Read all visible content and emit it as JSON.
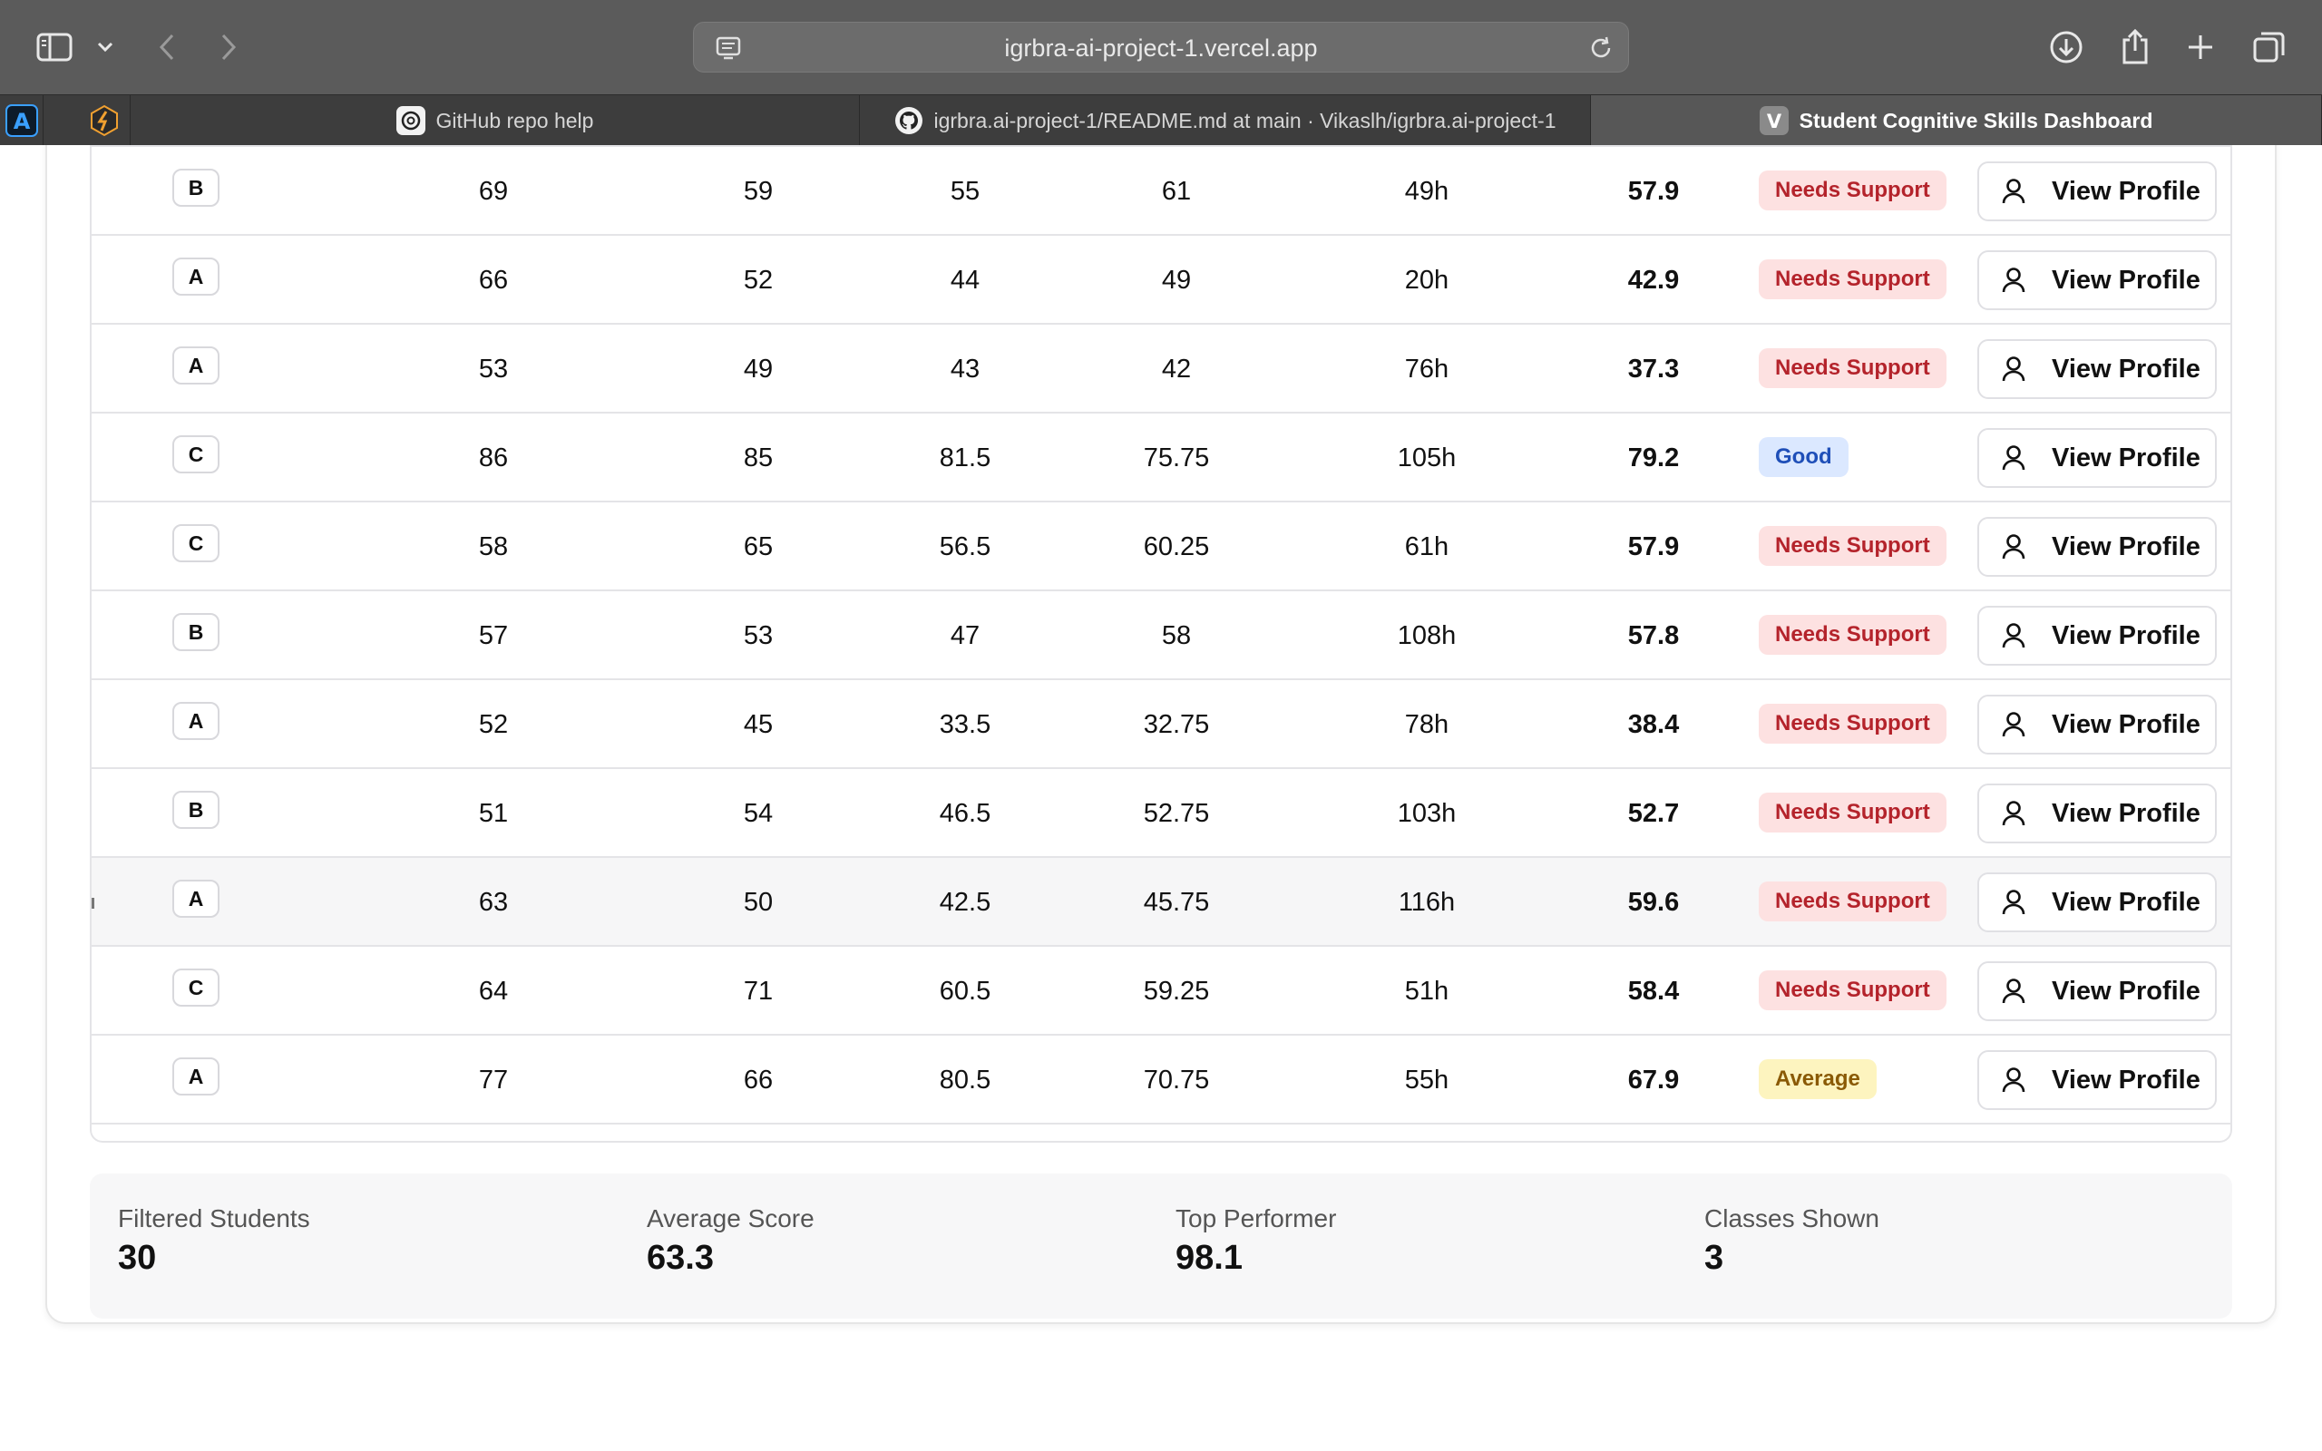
{
  "browser": {
    "url": "igrbra-ai-project-1.vercel.app",
    "tabs": [
      {
        "title": "GitHub repo help",
        "favicon": "openai-icon"
      },
      {
        "title": "igrbra.ai-project-1/README.md at main · Vikaslh/igrbra.ai-project-1",
        "favicon": "github-icon"
      },
      {
        "title": "Student Cognitive Skills Dashboard",
        "favicon": "v-icon",
        "favicon_letter": "V"
      }
    ]
  },
  "table": {
    "rows": [
      {
        "class": "B",
        "c1": "69",
        "c2": "59",
        "c3": "55",
        "c4": "61",
        "hours": "49h",
        "score": "57.9",
        "status": "Needs Support",
        "status_kind": "ns",
        "action": "View Profile"
      },
      {
        "class": "A",
        "c1": "66",
        "c2": "52",
        "c3": "44",
        "c4": "49",
        "hours": "20h",
        "score": "42.9",
        "status": "Needs Support",
        "status_kind": "ns",
        "action": "View Profile"
      },
      {
        "class": "A",
        "c1": "53",
        "c2": "49",
        "c3": "43",
        "c4": "42",
        "hours": "76h",
        "score": "37.3",
        "status": "Needs Support",
        "status_kind": "ns",
        "action": "View Profile"
      },
      {
        "class": "C",
        "c1": "86",
        "c2": "85",
        "c3": "81.5",
        "c4": "75.75",
        "hours": "105h",
        "score": "79.2",
        "status": "Good",
        "status_kind": "good",
        "action": "View Profile"
      },
      {
        "class": "C",
        "c1": "58",
        "c2": "65",
        "c3": "56.5",
        "c4": "60.25",
        "hours": "61h",
        "score": "57.9",
        "status": "Needs Support",
        "status_kind": "ns",
        "action": "View Profile"
      },
      {
        "class": "B",
        "c1": "57",
        "c2": "53",
        "c3": "47",
        "c4": "58",
        "hours": "108h",
        "score": "57.8",
        "status": "Needs Support",
        "status_kind": "ns",
        "action": "View Profile"
      },
      {
        "class": "A",
        "c1": "52",
        "c2": "45",
        "c3": "33.5",
        "c4": "32.75",
        "hours": "78h",
        "score": "38.4",
        "status": "Needs Support",
        "status_kind": "ns",
        "action": "View Profile"
      },
      {
        "class": "B",
        "c1": "51",
        "c2": "54",
        "c3": "46.5",
        "c4": "52.75",
        "hours": "103h",
        "score": "52.7",
        "status": "Needs Support",
        "status_kind": "ns",
        "action": "View Profile"
      },
      {
        "class": "A",
        "c1": "63",
        "c2": "50",
        "c3": "42.5",
        "c4": "45.75",
        "hours": "116h",
        "score": "59.6",
        "status": "Needs Support",
        "status_kind": "ns",
        "action": "View Profile",
        "hovered": true
      },
      {
        "class": "C",
        "c1": "64",
        "c2": "71",
        "c3": "60.5",
        "c4": "59.25",
        "hours": "51h",
        "score": "58.4",
        "status": "Needs Support",
        "status_kind": "ns",
        "action": "View Profile"
      },
      {
        "class": "A",
        "c1": "77",
        "c2": "66",
        "c3": "80.5",
        "c4": "70.75",
        "hours": "55h",
        "score": "67.9",
        "status": "Average",
        "status_kind": "avg",
        "action": "View Profile"
      }
    ]
  },
  "summary": [
    {
      "label": "Filtered Students",
      "value": "30"
    },
    {
      "label": "Average Score",
      "value": "63.3"
    },
    {
      "label": "Top Performer",
      "value": "98.1"
    },
    {
      "label": "Classes Shown",
      "value": "3"
    }
  ],
  "colors": {
    "needs_support_bg": "#fde1e1",
    "needs_support_text": "#b4232b",
    "good_bg": "#dbe8ff",
    "good_text": "#1f4fb8",
    "average_bg": "#fdf4bf",
    "average_text": "#8a5a05"
  }
}
